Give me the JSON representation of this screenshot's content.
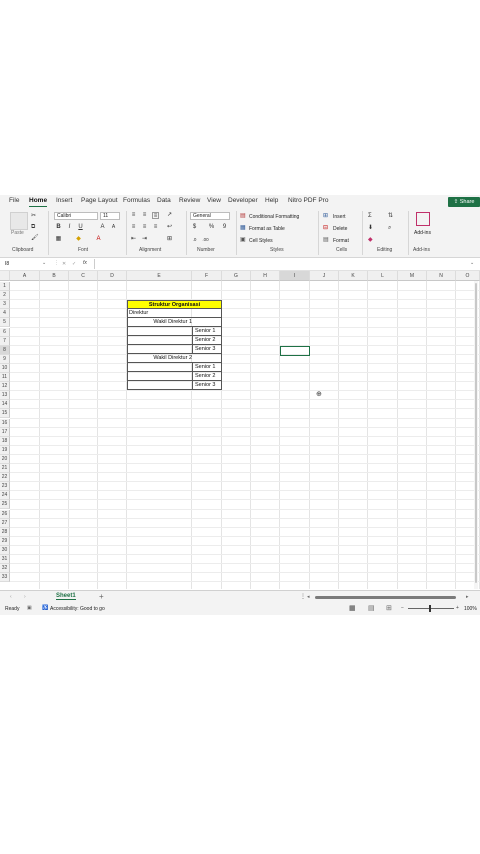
{
  "ribbon_tabs": [
    "File",
    "Home",
    "Insert",
    "Page Layout",
    "Formulas",
    "Data",
    "Review",
    "View",
    "Developer",
    "Help",
    "Nitro PDF Pro"
  ],
  "share_label": "Share",
  "ribbon": {
    "paste_label": "Paste",
    "font_name": "Calibri",
    "font_size": "11",
    "number_format": "General",
    "conditional_formatting": "Conditional Formatting",
    "format_as_table": "Format as Table",
    "cell_styles": "Cell Styles",
    "insert": "Insert",
    "delete": "Delete",
    "format": "Format",
    "addins": "Add-ins",
    "groups": [
      "Clipboard",
      "Font",
      "Alignment",
      "Number",
      "Styles",
      "Cells",
      "Editing",
      "Add-ins"
    ]
  },
  "formula_bar": {
    "name_box": "I8",
    "fx": "fx",
    "value": ""
  },
  "columns": [
    "A",
    "B",
    "C",
    "D",
    "E",
    "F",
    "G",
    "H",
    "I",
    "J",
    "K",
    "L",
    "M",
    "N",
    "O"
  ],
  "rows": [
    "1",
    "2",
    "3",
    "4",
    "5",
    "6",
    "7",
    "8",
    "9",
    "10",
    "11",
    "12",
    "13",
    "14",
    "15",
    "16",
    "17",
    "18",
    "19",
    "20",
    "21",
    "22",
    "23",
    "24",
    "25",
    "26",
    "27",
    "28",
    "29",
    "30",
    "31",
    "32",
    "33"
  ],
  "table": {
    "title": "Struktur Organisasi",
    "direktur": "Direktur",
    "wakil1": "Wakil Direktur 1",
    "wakil2": "Wakil Direktur 2",
    "senior1": "Senior 1",
    "senior2": "Senior 2",
    "senior3": "Senior 3",
    "title_fill": "#ffff00"
  },
  "sheet_tab": "Sheet1",
  "status": {
    "ready": "Ready",
    "accessibility": "Accessibility: Good to go",
    "zoom": "100%"
  },
  "colors": {
    "accent": "#1e7145"
  }
}
